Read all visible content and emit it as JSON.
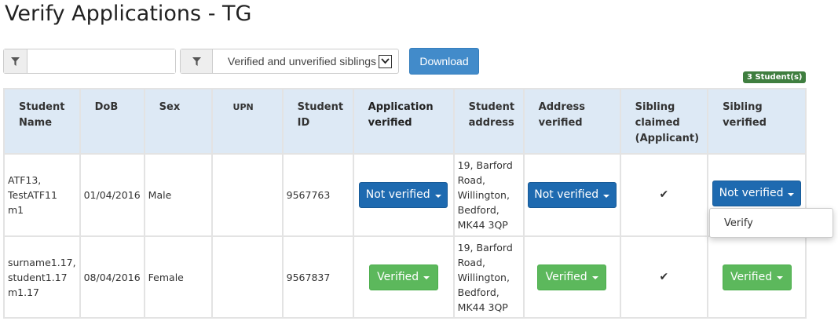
{
  "page": {
    "title": "Verify Applications - TG"
  },
  "filters": {
    "search_value": "",
    "sibling_filter": "Verified and unverified siblings",
    "filter_icon": "filter-icon"
  },
  "download_label": "Download",
  "student_count": "3 Student(s)",
  "table": {
    "headers": {
      "name": "Student Name",
      "dob": "DoB",
      "sex": "Sex",
      "upn": "UPN",
      "id": "Student ID",
      "app_verified": "Application verified",
      "address": "Student address",
      "addr_verified": "Address verified",
      "sib_claimed": "Sibling claimed (Applicant)",
      "sib_verified": "Sibling verified"
    },
    "rows": [
      {
        "name": "ATF13, TestATF11 m1",
        "dob": "01/04/2016",
        "sex": "Male",
        "upn": "",
        "id": "9567763",
        "app_verified": "Not verified",
        "address": "19, Barford Road, Willington, Bedford, MK44 3QP",
        "addr_verified": "Not verified",
        "sib_claimed": "✔",
        "sib_verified": "Not verified"
      },
      {
        "name": "surname1.17, student1.17 m1.17",
        "dob": "08/04/2016",
        "sex": "Female",
        "upn": "",
        "id": "9567837",
        "app_verified": "Verified",
        "address": "19, Barford Road, Willington, Bedford, MK44 3QP",
        "addr_verified": "Verified",
        "sib_claimed": "✔",
        "sib_verified": "Verified"
      }
    ]
  },
  "dropdown": {
    "item": "Verify"
  },
  "colors": {
    "primary": "#428bca",
    "not_verified": "#1e6ab0",
    "verified": "#5cb85c",
    "header_bg": "#dde9f5"
  }
}
